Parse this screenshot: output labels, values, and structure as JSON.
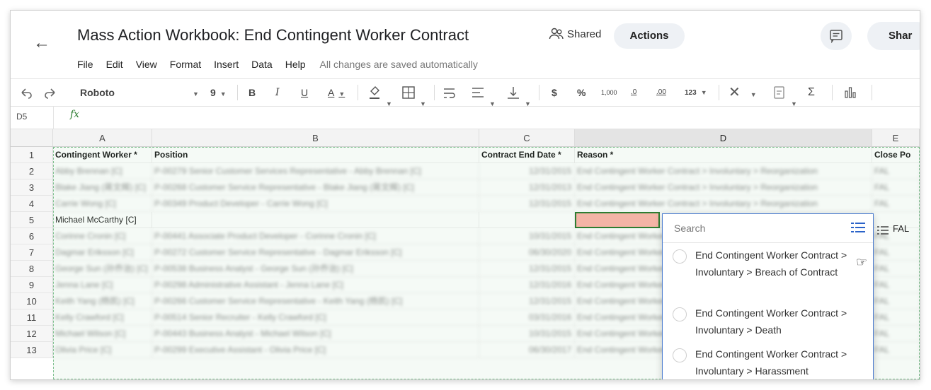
{
  "header": {
    "title": "Mass Action Workbook: End Contingent Worker Contract",
    "shared_label": "Shared",
    "actions_label": "Actions",
    "share_label": "Shar"
  },
  "menu": {
    "items": [
      "File",
      "Edit",
      "View",
      "Format",
      "Insert",
      "Data",
      "Help"
    ],
    "status": "All changes are saved automatically"
  },
  "toolbar": {
    "font": "Roboto",
    "size": "9",
    "bold": "B",
    "italic": "I",
    "underline": "U",
    "textcolor": "A",
    "dollar": "$",
    "percent": "%",
    "thousands": "1,000",
    "dec_minus": ".0",
    "dec_plus": ".00",
    "number": "123",
    "sigma": "Σ"
  },
  "formula_bar": {
    "cell_ref": "D5",
    "fx": "fx"
  },
  "grid": {
    "columns": [
      "A",
      "B",
      "C",
      "D",
      "E"
    ],
    "rows": [
      "1",
      "2",
      "3",
      "4",
      "5",
      "6",
      "7",
      "8",
      "9",
      "10",
      "11",
      "12",
      "13"
    ],
    "headers": {
      "a": "Contingent Worker *",
      "b": "Position",
      "c": "Contract End Date *",
      "d": "Reason *",
      "e": "Close Po"
    },
    "data": [
      {
        "a": "Abby Brennan [C]",
        "b": "P-00279 Senior Customer Services Representative - Abby Brennan [C]",
        "c": "12/31/2015",
        "d": "End Contingent Worker Contract > Involuntary > Reorganization",
        "e": "FAL"
      },
      {
        "a": "Blake Jiang (蒋文辉) [C]",
        "b": "P-00268 Customer Service Representative - Blake Jiang (蒋文辉) [C]",
        "c": "12/31/2013",
        "d": "End Contingent Worker Contract > Involuntary > Reorganization",
        "e": "FAL"
      },
      {
        "a": "Carrie Wong [C]",
        "b": "P-00349 Product Developer - Carrie Wong [C]",
        "c": "12/31/2015",
        "d": "End Contingent Worker Contract > Involuntary > Reorganization",
        "e": "FAL"
      },
      {
        "a": "Michael McCarthy [C]",
        "b": "",
        "c": "",
        "d": "",
        "e": "FAL"
      },
      {
        "a": "Corinne Cronin [C]",
        "b": "P-00441 Associate Product Developer - Corinne Cronin [C]",
        "c": "10/31/2015",
        "d": "End Contingent Worker",
        "e": "FAL"
      },
      {
        "a": "Dagmar Eriksson [C]",
        "b": "P-00272 Customer Service Representative - Dagmar Eriksson [C]",
        "c": "06/30/2020",
        "d": "End Contingent Worker",
        "e": "FAL"
      },
      {
        "a": "George Sun (孙乔治) [C]",
        "b": "P-00538 Business Analyst - George Sun (孙乔治) [C]",
        "c": "12/31/2015",
        "d": "End Contingent Worker",
        "e": "FAL"
      },
      {
        "a": "Jenna Lane [C]",
        "b": "P-00298 Administrative Assistant - Jenna Lane [C]",
        "c": "12/31/2016",
        "d": "End Contingent Worker",
        "e": "FAL"
      },
      {
        "a": "Keith Yang (杨凯) [C]",
        "b": "P-00266 Customer Service Representative - Keith Yang (杨凯) [C]",
        "c": "12/31/2015",
        "d": "End Contingent Worker",
        "e": "FAL"
      },
      {
        "a": "Kelly Crawford [C]",
        "b": "P-00514 Senior Recruiter - Kelly Crawford [C]",
        "c": "03/31/2016",
        "d": "End Contingent Worker",
        "e": "FAL"
      },
      {
        "a": "Michael Wilson [C]",
        "b": "P-00443 Business Analyst - Michael Wilson [C]",
        "c": "10/31/2015",
        "d": "End Contingent Worker",
        "e": "FAL"
      },
      {
        "a": "Olivia Price [C]",
        "b": "P-00299 Executive Assistant - Olivia Price [C]",
        "c": "06/30/2017",
        "d": "End Contingent Worker",
        "e": "FAL"
      }
    ]
  },
  "dropdown": {
    "search_placeholder": "Search",
    "options": [
      "End Contingent Worker Contract > Involuntary > Breach of Contract",
      "End Contingent Worker Contract > Involuntary > Death",
      "End Contingent Worker Contract > Involuntary > Harassment"
    ]
  },
  "row5_e": "FAL"
}
